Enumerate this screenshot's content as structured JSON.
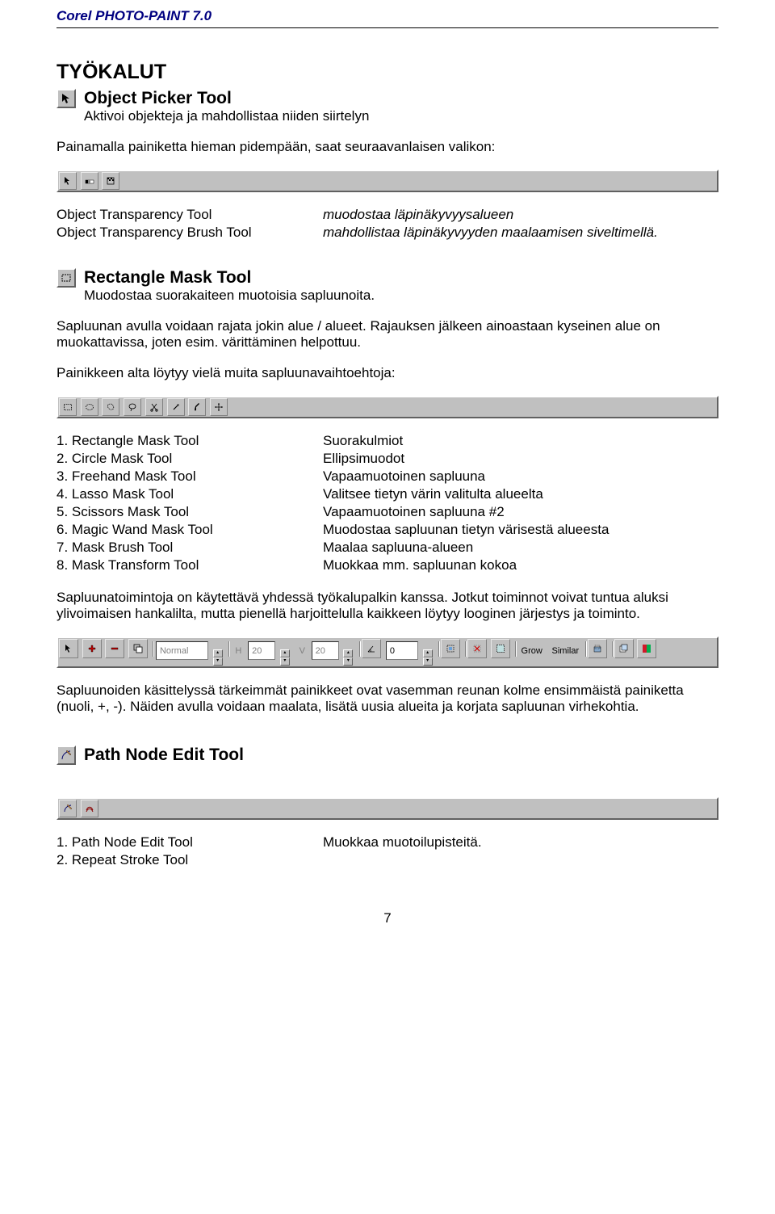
{
  "doc_header": "Corel PHOTO-PAINT 7.0",
  "h1": "TYÖKALUT",
  "object_picker": {
    "title": "Object Picker Tool",
    "desc": "Aktivoi objekteja ja mahdollistaa niiden siirtelyn"
  },
  "press_longer": "Painamalla painiketta hieman pidempään, saat seuraavanlaisen valikon:",
  "transparency_rows": [
    {
      "left": "Object Transparency Tool",
      "right": "muodostaa läpinäkyvyysalueen"
    },
    {
      "left": "Object Transparency Brush Tool",
      "right": "mahdollistaa läpinäkyvyyden maalaamisen siveltimellä."
    }
  ],
  "rect_mask": {
    "title": "Rectangle Mask Tool",
    "desc": "Muodostaa suorakaiteen muotoisia sapluunoita."
  },
  "sapluuna_p1": "Sapluunan avulla voidaan rajata jokin alue / alueet. Rajauksen jälkeen ainoastaan kyseinen alue on muokattavissa, joten esim. värittäminen helpottuu.",
  "sapluuna_p2": "Painikkeen alta löytyy vielä muita sapluunavaihtoehtoja:",
  "mask_tools": [
    {
      "num": "1. Rectangle Mask Tool",
      "desc": "Suorakulmiot"
    },
    {
      "num": "2. Circle Mask Tool",
      "desc": "Ellipsimuodot"
    },
    {
      "num": "3. Freehand Mask Tool",
      "desc": "Vapaamuotoinen sapluuna"
    },
    {
      "num": "4. Lasso Mask Tool",
      "desc": "Valitsee tietyn värin valitulta alueelta"
    },
    {
      "num": "5. Scissors Mask Tool",
      "desc": "Vapaamuotoinen sapluuna #2"
    },
    {
      "num": "6. Magic Wand Mask Tool",
      "desc": "Muodostaa sapluunan tietyn värisestä alueesta"
    },
    {
      "num": "7. Mask Brush Tool",
      "desc": "Maalaa sapluuna-alueen"
    },
    {
      "num": "8. Mask Transform Tool",
      "desc": "Muokkaa mm. sapluunan kokoa"
    }
  ],
  "sapluuna_p3": "Sapluunatoimintoja on käytettävä yhdessä työkalupalkin kanssa. Jotkut toiminnot voivat tuntua aluksi ylivoimaisen hankalilta, mutta pienellä harjoittelulla kaikkeen löytyy looginen järjestys ja toiminto.",
  "toolbar_wide": {
    "mode": "Normal",
    "h_label": "H",
    "h_val": "20",
    "v_label": "V",
    "v_val": "20",
    "ang_val": "0",
    "grow": "Grow",
    "similar": "Similar"
  },
  "sapluuna_p4": "Sapluunoiden käsittelyssä tärkeimmät painikkeet ovat vasemman reunan kolme ensimmäistä painiketta (nuoli, +, -). Näiden avulla voidaan maalata, lisätä uusia alueita ja korjata sapluunan virhekohtia.",
  "path_node": {
    "title": "Path Node Edit Tool"
  },
  "path_tools": [
    {
      "num": "1. Path Node Edit Tool",
      "desc": "Muokkaa muotoilupisteitä."
    },
    {
      "num": "2. Repeat Stroke Tool",
      "desc": ""
    }
  ],
  "page_num": "7"
}
